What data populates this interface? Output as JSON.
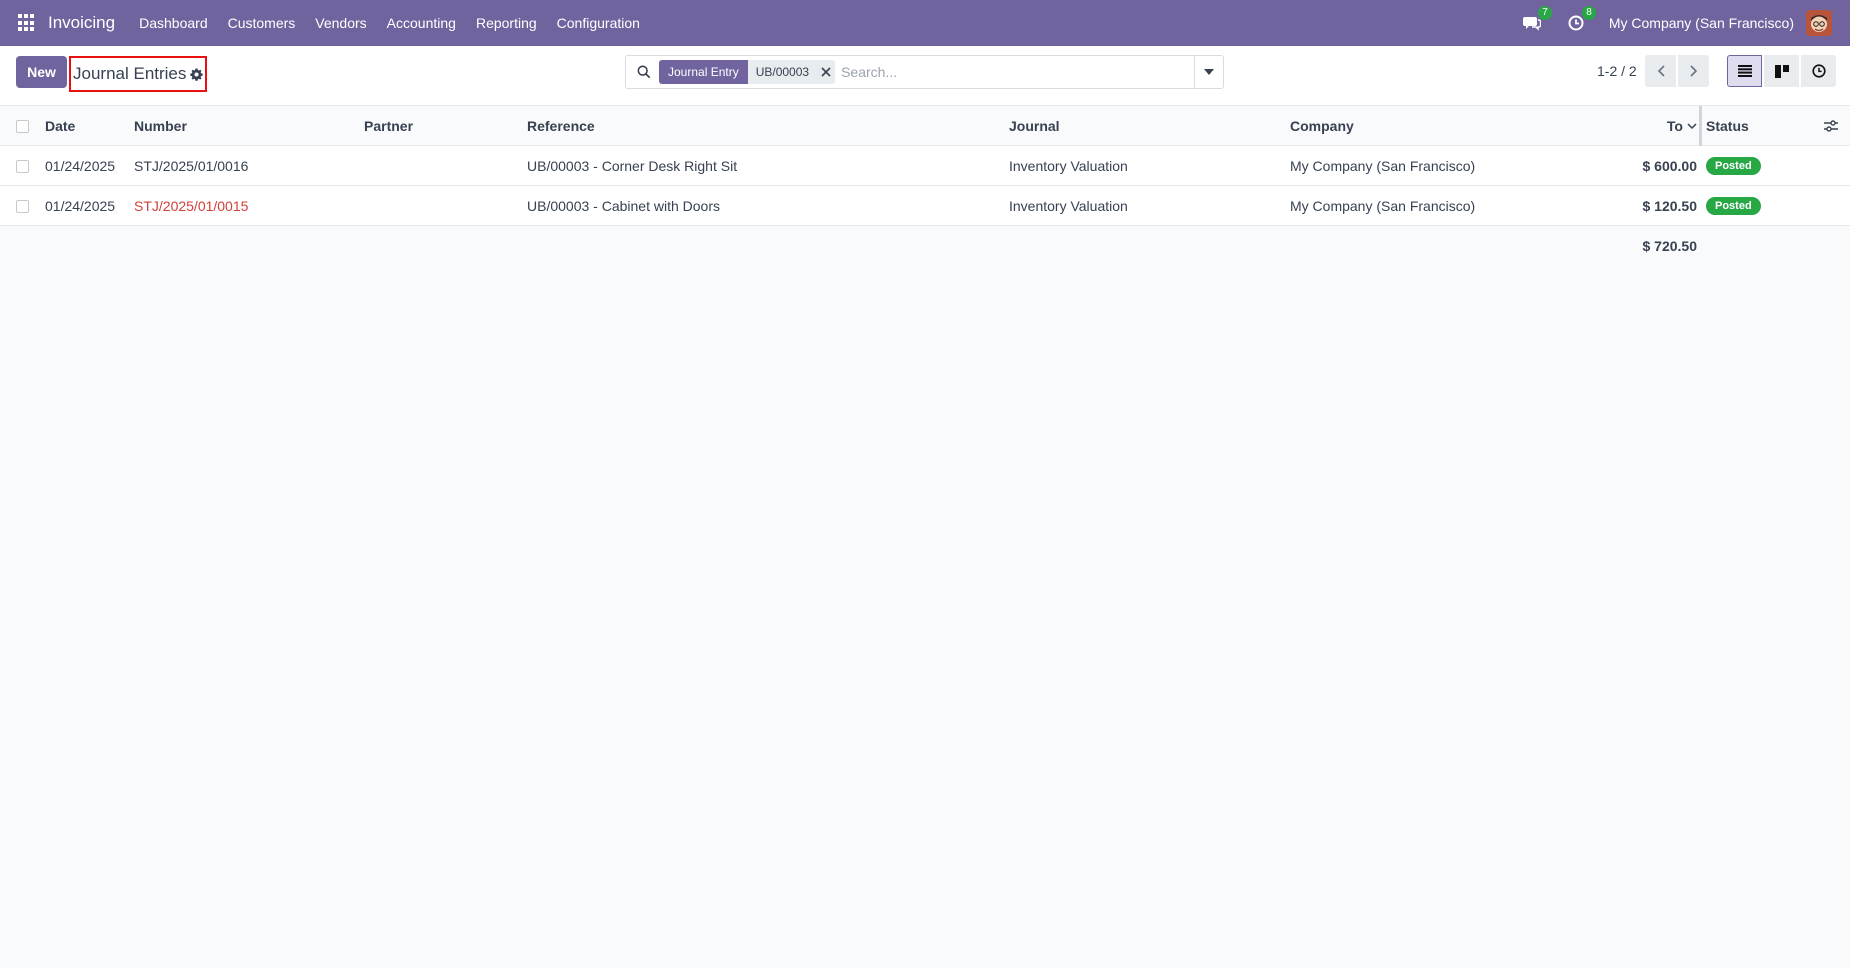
{
  "navbar": {
    "brand": "Invoicing",
    "menu": [
      "Dashboard",
      "Customers",
      "Vendors",
      "Accounting",
      "Reporting",
      "Configuration"
    ],
    "messages_badge": "7",
    "activities_badge": "8",
    "company": "My Company (San Francisco)"
  },
  "control_panel": {
    "new_label": "New",
    "title": "Journal Entries",
    "search": {
      "facet_label": "Journal Entry",
      "facet_value": "UB/00003",
      "placeholder": "Search..."
    },
    "pager": "1-2 / 2"
  },
  "table": {
    "columns": {
      "date": "Date",
      "number": "Number",
      "partner": "Partner",
      "reference": "Reference",
      "journal": "Journal",
      "company": "Company",
      "total": "To",
      "status": "Status"
    },
    "rows": [
      {
        "date": "01/24/2025",
        "number": "STJ/2025/01/0016",
        "partner": "",
        "reference": "UB/00003 - Corner Desk Right Sit",
        "journal": "Inventory Valuation",
        "company": "My Company (San Francisco)",
        "total": "$ 600.00",
        "status": "Posted"
      },
      {
        "date": "01/24/2025",
        "number": "STJ/2025/01/0015",
        "partner": "",
        "reference": "UB/00003 - Cabinet with Doors",
        "journal": "Inventory Valuation",
        "company": "My Company (San Francisco)",
        "total": "$ 120.50",
        "status": "Posted"
      }
    ],
    "grand_total": "$ 720.50"
  },
  "colors": {
    "brand": "#71639e",
    "success": "#28a745",
    "danger": "#d23f3a"
  }
}
